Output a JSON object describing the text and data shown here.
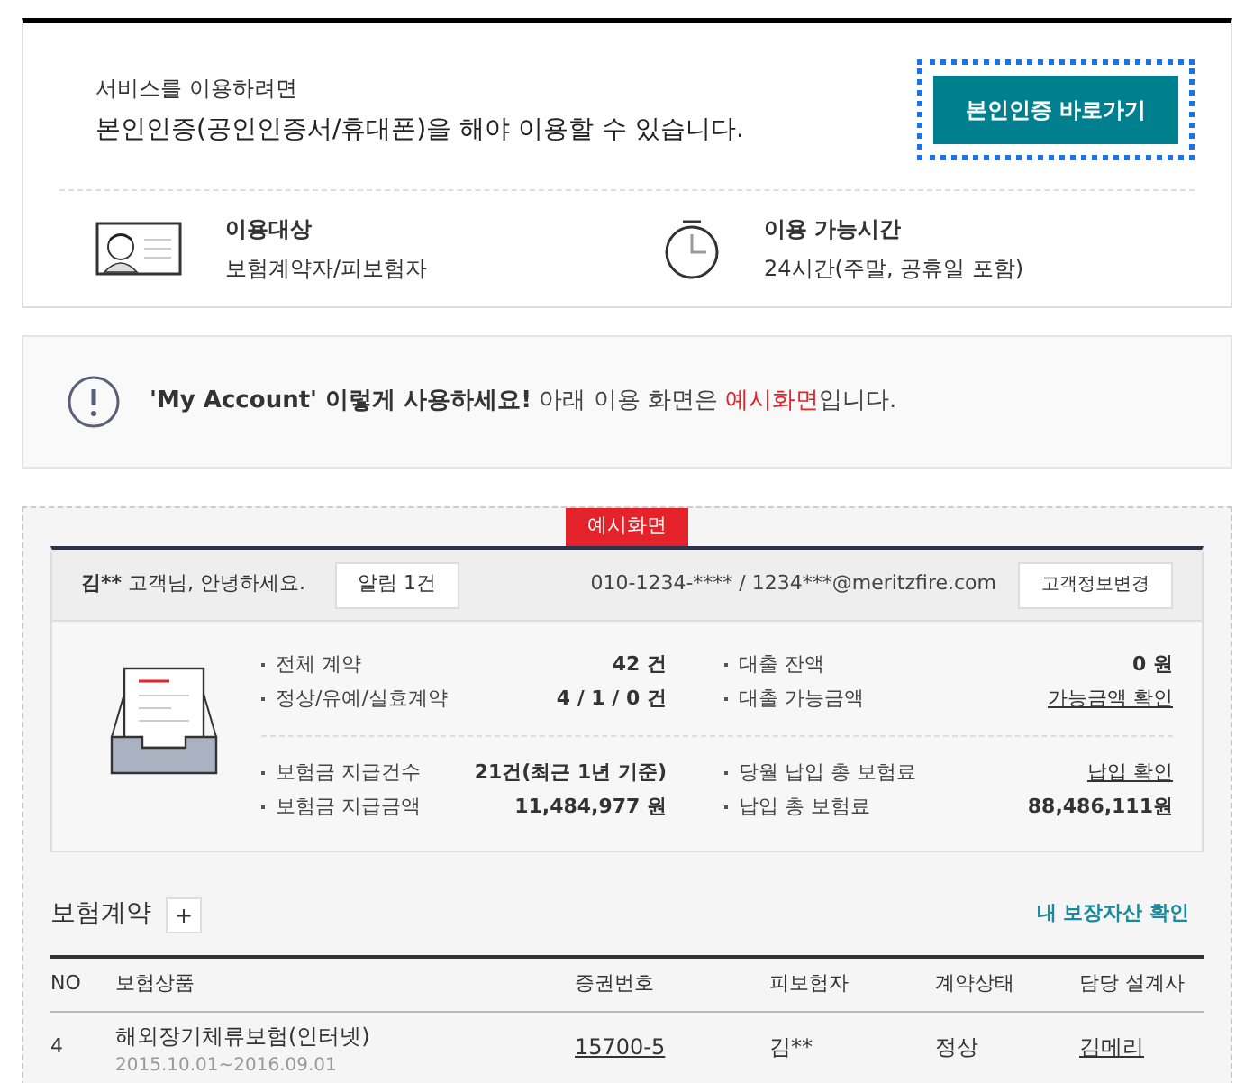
{
  "intro": {
    "line1": "서비스를 이용하려면",
    "line2": "본인인증(공인인증서/휴대폰)을 해야 이용할 수 있습니다.",
    "button": "본인인증 바로가기"
  },
  "info": [
    {
      "kind": "id-card",
      "title": "이용대상",
      "desc": "보험계약자/피보험자"
    },
    {
      "kind": "clock",
      "title": "이용 가능시간",
      "desc": "24시간(주말, 공휴일 포함)"
    }
  ],
  "notice": [
    {
      "kind": "strong",
      "text": "'My Account' 이렇게 사용하세요!"
    },
    {
      "kind": "plain",
      "text": " 아래 이용 화면은 "
    },
    {
      "kind": "highlight",
      "text": "예시화면"
    },
    {
      "kind": "plain",
      "text": "입니다."
    }
  ],
  "example": {
    "badge": "예시화면",
    "customer": "김**",
    "greeting": "고객님, 안녕하세요.",
    "alert_button": "알림 1건",
    "contact": "010-1234-**** / 1234***@meritzfire.com",
    "edit_button": "고객정보변경",
    "groups": [
      {
        "left": [
          {
            "label": "전체 계약",
            "value": "42 건"
          },
          {
            "label": "정상/유예/실효계약",
            "value": "4 / 1 / 0 건"
          }
        ],
        "right": [
          {
            "label": "대출 잔액",
            "value": "0 원",
            "kind": "text"
          },
          {
            "label": "대출 가능금액",
            "value": "가능금액 확인",
            "kind": "link"
          }
        ]
      },
      {
        "left": [
          {
            "label": "보험금 지급건수",
            "value": "21건(최근 1년 기준)"
          },
          {
            "label": "보험금 지급금액",
            "value": "11,484,977 원"
          }
        ],
        "right": [
          {
            "label": "당월 납입 총 보험료",
            "value": "납입 확인",
            "kind": "link"
          },
          {
            "label": "납입 총 보험료",
            "value": "88,486,111원",
            "kind": "text"
          }
        ]
      }
    ]
  },
  "contracts": {
    "title": "보험계약",
    "add_button": "+",
    "link": "내 보장자산 확인",
    "columns": [
      "NO",
      "보험상품",
      "증권번호",
      "피보험자",
      "계약상태",
      "담당 설계사"
    ],
    "rows": [
      {
        "no": "4",
        "product": "해외장기체류보험(인터넷)",
        "period": "2015.10.01~2016.09.01",
        "policy_no": "15700-5",
        "insured": "김**",
        "status": "정상",
        "planner": "김메리"
      }
    ]
  }
}
